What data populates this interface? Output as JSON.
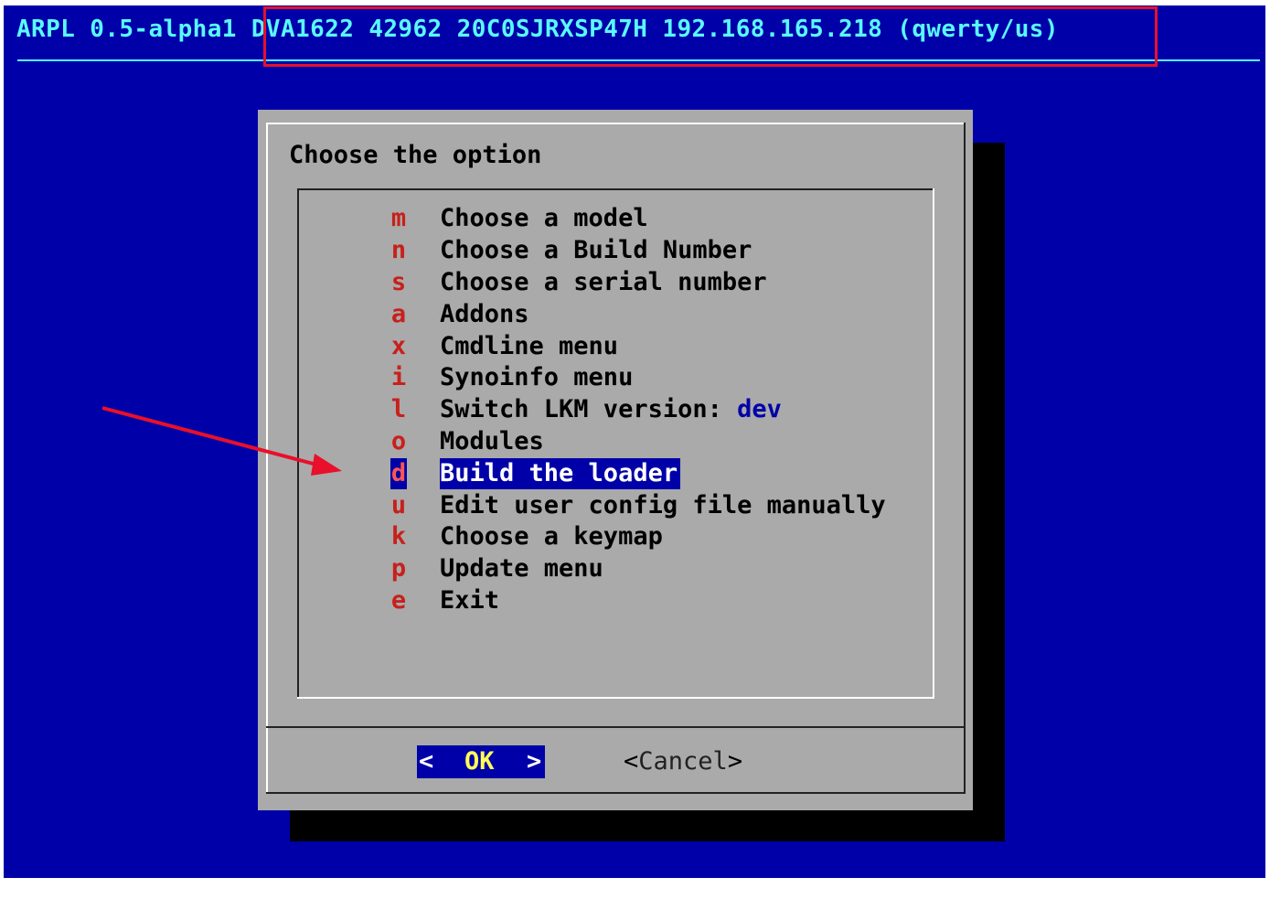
{
  "header": {
    "app_version": "ARPL 0.5-alpha1",
    "model": "DVA1622",
    "build": "42962",
    "serial": "20C0SJRXSP47H",
    "ip": "192.168.165.218",
    "keymap": "(qwerty/us)"
  },
  "dialog": {
    "prompt": "Choose the option",
    "menu": [
      {
        "key": "m",
        "label": "Choose a model"
      },
      {
        "key": "n",
        "label": "Choose a Build Number"
      },
      {
        "key": "s",
        "label": "Choose a serial number"
      },
      {
        "key": "a",
        "label": "Addons"
      },
      {
        "key": "x",
        "label": "Cmdline menu"
      },
      {
        "key": "i",
        "label": "Synoinfo menu"
      },
      {
        "key": "l",
        "label": "Switch LKM version: ",
        "value": "dev"
      },
      {
        "key": "o",
        "label": "Modules"
      },
      {
        "key": "d",
        "label": "Build the loader",
        "selected": true
      },
      {
        "key": "u",
        "label": "Edit user config file manually"
      },
      {
        "key": "k",
        "label": "Choose a keymap"
      },
      {
        "key": "p",
        "label": "Update menu"
      },
      {
        "key": "e",
        "label": "Exit"
      }
    ],
    "buttons": {
      "ok": {
        "open": "<",
        "label": "OK",
        "close": ">"
      },
      "cancel": {
        "open": "<",
        "label": "Cancel",
        "close": ">"
      }
    }
  },
  "colors": {
    "background": "#0000a8",
    "dialog": "#aaaaaa",
    "hotkey": "#c8201c",
    "highlight_box": "#e8102a",
    "annotation_arrow": "#e8102a",
    "header_text": "#5af7ff"
  }
}
